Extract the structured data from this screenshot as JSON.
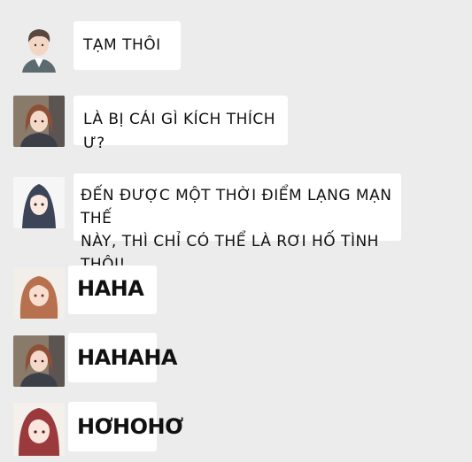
{
  "messages": [
    {
      "sender": "man-short-hair",
      "text": "TẠM THÔI"
    },
    {
      "sender": "woman-auburn-hair",
      "text": "LÀ BỊ CÁI GÌ KÍCH THÍCH Ư?"
    },
    {
      "sender": "woman-dark-hair",
      "text": "ĐẾN ĐƯỢC MỘT THỜI ĐIỂM LẠNG MẠN THẾ\nNÀY, THÌ CHỈ CÓ THỂ LÀ RƠI HỐ TÌNH THÔI!"
    },
    {
      "sender": "woman-ginger-hair",
      "text": "HAHA"
    },
    {
      "sender": "woman-auburn-hair",
      "text": "HAHAHA"
    },
    {
      "sender": "woman-red-hair",
      "text": "HƠHOHƠ"
    }
  ],
  "colors": {
    "background": "#ececec",
    "bubble": "#ffffff",
    "text": "#111111"
  }
}
